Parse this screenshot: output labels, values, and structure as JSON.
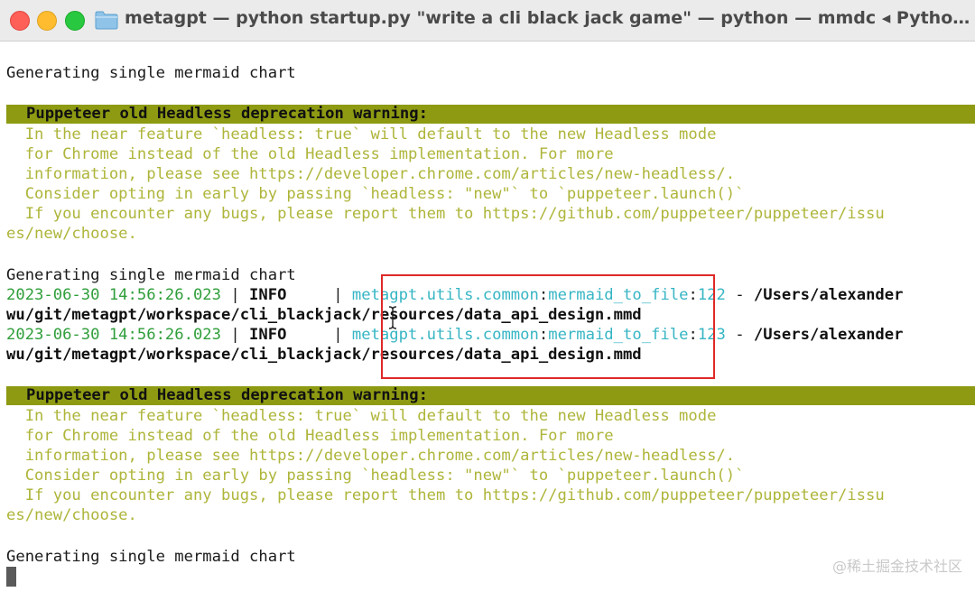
{
  "window": {
    "title": "metagpt — python startup.py \"write a cli black jack game\" — python — mmdc ◂ Python star…"
  },
  "terminal": {
    "gen_label": "Generating single mermaid chart",
    "warning": {
      "heading": "Puppeteer old Headless deprecation warning:",
      "lines": [
        "  In the near feature `headless: true` will default to the new Headless mode",
        "  for Chrome instead of the old Headless implementation. For more",
        "  information, please see https://developer.chrome.com/articles/new-headless/.",
        "  Consider opting in early by passing `headless: \"new\"` to `puppeteer.launch()`",
        "  If you encounter any bugs, please report them to https://github.com/puppeteer/puppeteer/issu",
        "es/new/choose."
      ]
    },
    "logs": [
      {
        "timestamp": "2023-06-30 14:56:26.023",
        "sep": " | ",
        "level": "INFO    ",
        "module": "metagpt.utils.common",
        "function": "mermaid_to_file",
        "line_no": "122",
        "dash": " - ",
        "message": "/Users/alexander",
        "wrap": "wu/git/metagpt/workspace/cli_blackjack/resources/data_api_design.mmd"
      },
      {
        "timestamp": "2023-06-30 14:56:26.023",
        "sep": " | ",
        "level": "INFO    ",
        "module": "metagpt.utils.common",
        "function": "mermaid_to_file",
        "line_no": "123",
        "dash": " - ",
        "message": "/Users/alexander",
        "wrap": "wu/git/metagpt/workspace/cli_blackjack/resources/data_api_design.mmd"
      }
    ]
  },
  "watermark": "@稀土掘金技术社区",
  "colors": {
    "banner": "#8d9a12",
    "warning_text": "#aeb53a",
    "timestamp": "#2f9e3a",
    "module": "#36b5c4",
    "highlight": "#e02828"
  },
  "icons": [
    "folder-icon",
    "text-cursor-icon",
    "block-cursor"
  ]
}
